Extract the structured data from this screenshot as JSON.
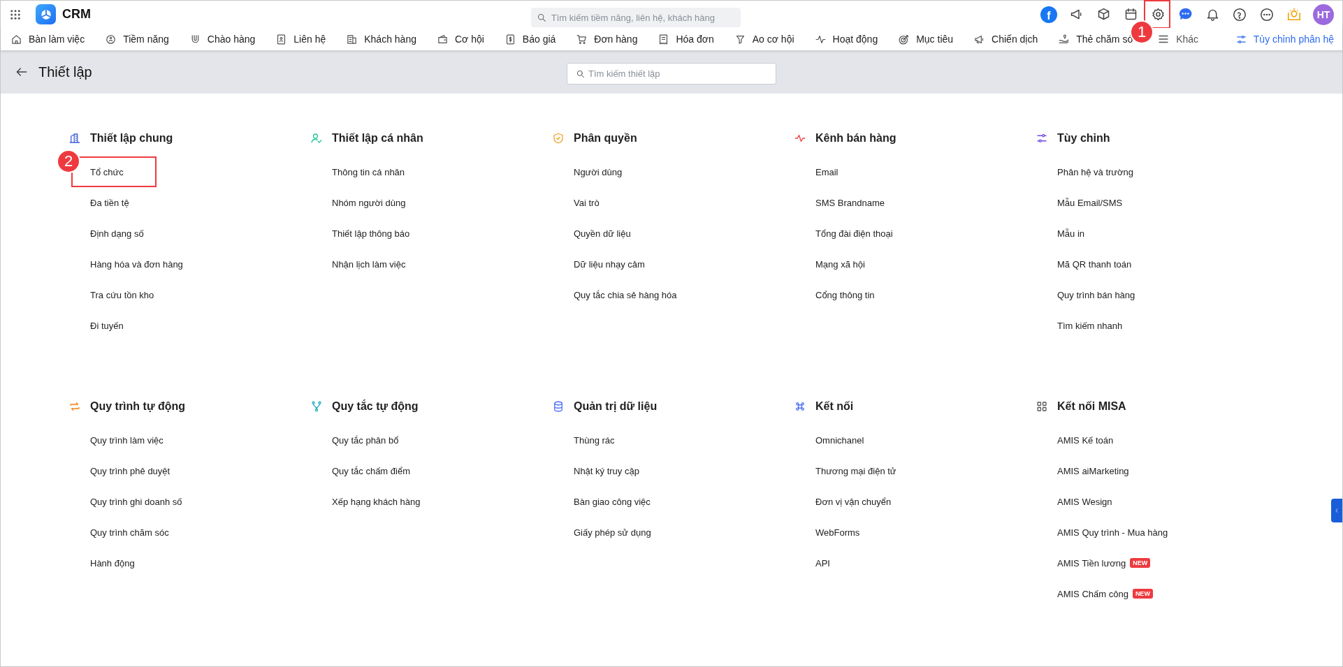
{
  "topbar": {
    "app_name": "CRM",
    "search_placeholder": "Tìm kiếm tiềm năng, liên hệ, khách hàng",
    "social_glyph": "f",
    "settings_callout": "1",
    "avatar_initials": "HT"
  },
  "nav": {
    "items": [
      "Bàn làm việc",
      "Tiềm năng",
      "Chào hàng",
      "Liên hệ",
      "Khách hàng",
      "Cơ hội",
      "Báo giá",
      "Đơn hàng",
      "Hóa đơn",
      "Ao cơ hội",
      "Hoạt động",
      "Mục tiêu",
      "Chiến dịch",
      "Thẻ chăm só"
    ],
    "more": "Khác",
    "customize": "Tùy chỉnh phân hệ"
  },
  "header": {
    "title": "Thiết lập",
    "search_placeholder": "Tìm kiếm thiết lập"
  },
  "sections": [
    {
      "title": "Thiết lập chung",
      "items": [
        {
          "label": "Tổ chức",
          "callout": "2"
        },
        {
          "label": "Đa tiền tệ"
        },
        {
          "label": "Định dạng số"
        },
        {
          "label": "Hàng hóa và đơn hàng"
        },
        {
          "label": "Tra cứu tồn kho"
        },
        {
          "label": "Đi tuyến"
        }
      ]
    },
    {
      "title": "Thiết lập cá nhân",
      "items": [
        {
          "label": "Thông tin cá nhân"
        },
        {
          "label": "Nhóm người dùng"
        },
        {
          "label": "Thiết lập thông báo"
        },
        {
          "label": "Nhận lịch làm việc"
        }
      ]
    },
    {
      "title": "Phân quyền",
      "items": [
        {
          "label": "Người dùng"
        },
        {
          "label": "Vai trò"
        },
        {
          "label": "Quyền dữ liệu"
        },
        {
          "label": "Dữ liệu nhạy cảm"
        },
        {
          "label": "Quy tắc chia sẻ hàng hóa"
        }
      ]
    },
    {
      "title": "Kênh bán hàng",
      "items": [
        {
          "label": "Email"
        },
        {
          "label": "SMS Brandname"
        },
        {
          "label": "Tổng đài điện thoại"
        },
        {
          "label": "Mạng xã hội"
        },
        {
          "label": "Cổng thông tin"
        }
      ]
    },
    {
      "title": "Tùy chỉnh",
      "items": [
        {
          "label": "Phân hệ và trường"
        },
        {
          "label": "Mẫu Email/SMS"
        },
        {
          "label": "Mẫu in"
        },
        {
          "label": "Mã QR thanh toán"
        },
        {
          "label": "Quy trình bán hàng"
        },
        {
          "label": "Tìm kiếm nhanh"
        }
      ]
    },
    {
      "title": "Quy trình tự động",
      "items": [
        {
          "label": "Quy trình làm việc"
        },
        {
          "label": "Quy trình phê duyệt"
        },
        {
          "label": "Quy trình ghi doanh số"
        },
        {
          "label": "Quy trình chăm sóc"
        },
        {
          "label": "Hành động"
        }
      ]
    },
    {
      "title": "Quy tắc tự động",
      "items": [
        {
          "label": "Quy tắc phân bổ"
        },
        {
          "label": "Quy tắc chấm điểm"
        },
        {
          "label": "Xếp hạng khách hàng"
        }
      ]
    },
    {
      "title": "Quản trị dữ liệu",
      "items": [
        {
          "label": "Thùng rác"
        },
        {
          "label": "Nhật ký truy cập"
        },
        {
          "label": "Bàn giao công việc"
        },
        {
          "label": "Giấy phép sử dụng"
        }
      ]
    },
    {
      "title": "Kết nối",
      "items": [
        {
          "label": "Omnichanel"
        },
        {
          "label": "Thương mại điện tử"
        },
        {
          "label": "Đơn vị vận chuyển"
        },
        {
          "label": "WebForms"
        },
        {
          "label": "API"
        }
      ]
    },
    {
      "title": "Kết nối MISA",
      "items": [
        {
          "label": "AMIS Kế toán"
        },
        {
          "label": "AMIS aiMarketing"
        },
        {
          "label": "AMIS Wesign"
        },
        {
          "label": "AMIS Quy trình - Mua hàng"
        },
        {
          "label": "AMIS Tiền lương",
          "badge": "NEW"
        },
        {
          "label": "AMIS Chấm công",
          "badge": "NEW"
        }
      ]
    }
  ]
}
